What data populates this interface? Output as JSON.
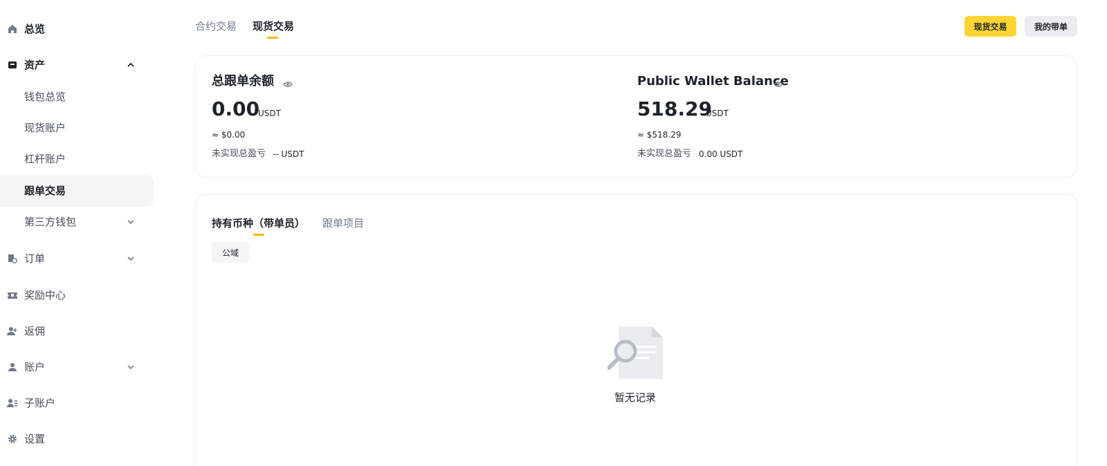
{
  "sidebar": {
    "items": [
      {
        "label": "总览",
        "icon": "home-icon"
      },
      {
        "label": "资产",
        "icon": "wallet-icon"
      },
      {
        "label": "钱包总览"
      },
      {
        "label": "现货账户"
      },
      {
        "label": "杠杆账户"
      },
      {
        "label": "跟单交易"
      },
      {
        "label": "第三方钱包"
      },
      {
        "label": "订单",
        "icon": "orders-icon"
      },
      {
        "label": "奖励中心",
        "icon": "ticket-icon"
      },
      {
        "label": "返佣",
        "icon": "user-plus-icon"
      },
      {
        "label": "账户",
        "icon": "user-icon"
      },
      {
        "label": "子账户",
        "icon": "sub-account-icon"
      },
      {
        "label": "设置",
        "icon": "gear-icon"
      }
    ]
  },
  "header": {
    "tabs": [
      {
        "label": "合约交易"
      },
      {
        "label": "现货交易"
      }
    ],
    "buttons": {
      "spot": "现货交易",
      "my_lead": "我的带单"
    }
  },
  "balances": {
    "copy": {
      "title": "总跟单余额",
      "amount": "0.00",
      "unit": "USDT",
      "approx": "≈ $0.00",
      "pnl_label": "未实现总盈亏",
      "pnl_value": "-- USDT"
    },
    "public": {
      "title": "Public Wallet Balance",
      "amount": "518.29",
      "unit": "USDT",
      "approx": "≈ $518.29",
      "pnl_label": "未实现总盈亏",
      "pnl_value": "0.00 USDT"
    }
  },
  "list": {
    "tabs": [
      {
        "label": "持有币种（带单员）"
      },
      {
        "label": "跟单项目"
      }
    ],
    "chip": "公域",
    "empty": "暂无记录"
  },
  "colors": {
    "accent": "#fcd535",
    "underline": "#f0b90b",
    "text": "#1e2329",
    "muted": "#707a8a"
  }
}
